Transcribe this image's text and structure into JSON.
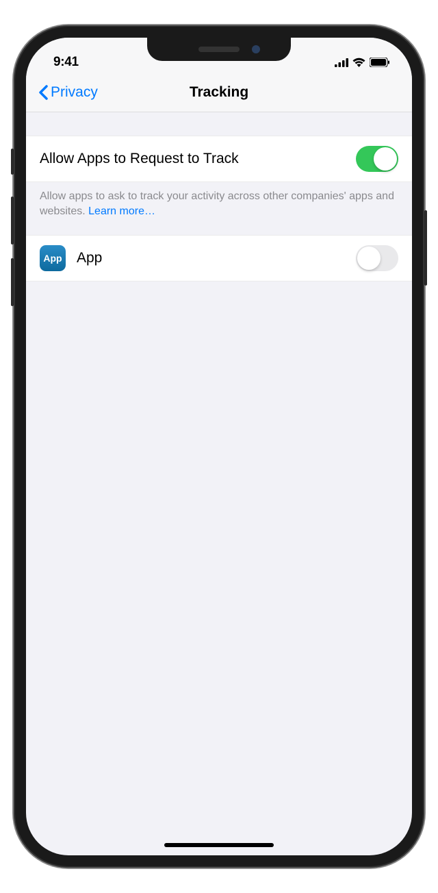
{
  "status": {
    "time": "9:41"
  },
  "nav": {
    "back_label": "Privacy",
    "title": "Tracking"
  },
  "main": {
    "allow_label": "Allow Apps to Request to Track",
    "allow_toggle_on": true,
    "footer_text": "Allow apps to ask to track your activity across other companies' apps and websites. ",
    "learn_more": "Learn more…"
  },
  "apps": [
    {
      "icon_text": "App",
      "name": "App",
      "toggle_on": false
    }
  ]
}
